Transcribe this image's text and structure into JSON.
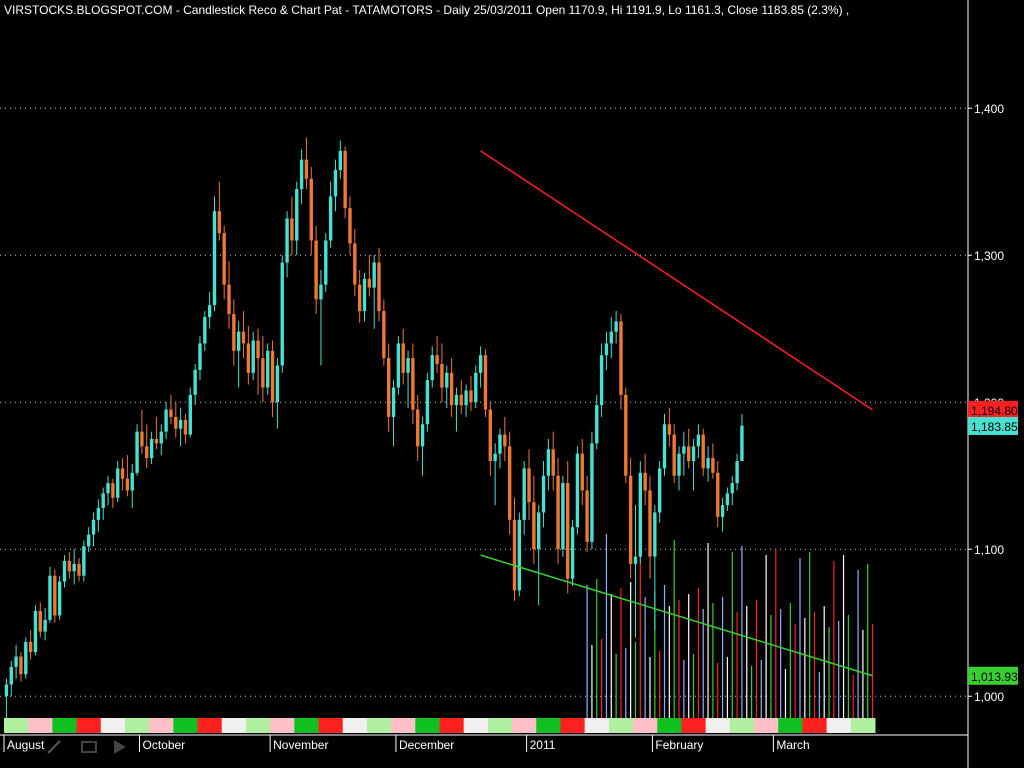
{
  "header": {
    "title": "VIRSTOCKS.BLOGSPOT.COM - Candlestick Reco & Chart Pat - TATAMOTORS - Daily 25/03/2011 Open 1170.9, Hi 1191.9, Lo 1161.3, Close 1183.85 (2.3%) ,"
  },
  "colors": {
    "background": "#000000",
    "up_candle": "#48e0d0",
    "down_candle": "#f07830",
    "resistance_line": "#ff2020",
    "support_line": "#38d030",
    "grid": "#ffffff",
    "axis": "#ffffff"
  },
  "chart_data": {
    "type": "candlestick",
    "symbol": "TATAMOTORS",
    "ylim": [
      975,
      1460
    ],
    "y_ticks": [
      1000,
      1100,
      1200,
      1300,
      1400
    ],
    "y_tick_labels": [
      "1,000",
      "1,100",
      "1,200",
      "1,300",
      "1,400"
    ],
    "x_labels": [
      {
        "label": "August",
        "index": 0
      },
      {
        "label": "October",
        "index": 28
      },
      {
        "label": "November",
        "index": 55
      },
      {
        "label": "December",
        "index": 81
      },
      {
        "label": "2011",
        "index": 108
      },
      {
        "label": "February",
        "index": 134
      },
      {
        "label": "March",
        "index": 159
      }
    ],
    "num_bars": 180,
    "price_tags": [
      {
        "label": "1,194.80",
        "value": 1194.8,
        "color": "#ff2020",
        "text_color": "#000000"
      },
      {
        "label": "1,183.85",
        "value": 1183.85,
        "color": "#48e0d0",
        "text_color": "#000000"
      },
      {
        "label": "1,013.93",
        "value": 1013.93,
        "color": "#38d030",
        "text_color": "#000000"
      }
    ],
    "trend_lines": [
      {
        "name": "resistance",
        "from": {
          "index": 98,
          "value": 1371
        },
        "to": {
          "index": 179,
          "value": 1194.8
        },
        "color": "#ff2020"
      },
      {
        "name": "support",
        "from": {
          "index": 98,
          "value": 1096
        },
        "to": {
          "index": 179,
          "value": 1013.93
        },
        "color": "#38d030"
      }
    ],
    "candles": [
      [
        1000,
        1012,
        985,
        1008
      ],
      [
        1008,
        1024,
        1000,
        1020
      ],
      [
        1020,
        1035,
        1012,
        1027
      ],
      [
        1027,
        1030,
        1010,
        1015
      ],
      [
        1015,
        1040,
        1012,
        1037
      ],
      [
        1037,
        1045,
        1025,
        1030
      ],
      [
        1030,
        1062,
        1028,
        1058
      ],
      [
        1058,
        1064,
        1040,
        1044
      ],
      [
        1044,
        1060,
        1038,
        1052
      ],
      [
        1052,
        1088,
        1050,
        1082
      ],
      [
        1082,
        1086,
        1050,
        1055
      ],
      [
        1055,
        1082,
        1052,
        1078
      ],
      [
        1078,
        1096,
        1074,
        1092
      ],
      [
        1092,
        1098,
        1080,
        1085
      ],
      [
        1085,
        1100,
        1076,
        1090
      ],
      [
        1090,
        1094,
        1078,
        1082
      ],
      [
        1082,
        1106,
        1078,
        1102
      ],
      [
        1102,
        1115,
        1098,
        1110
      ],
      [
        1110,
        1125,
        1102,
        1120
      ],
      [
        1120,
        1134,
        1112,
        1128
      ],
      [
        1128,
        1142,
        1120,
        1138
      ],
      [
        1138,
        1150,
        1130,
        1145
      ],
      [
        1145,
        1148,
        1128,
        1135
      ],
      [
        1135,
        1160,
        1132,
        1155
      ],
      [
        1155,
        1162,
        1140,
        1148
      ],
      [
        1148,
        1164,
        1136,
        1140
      ],
      [
        1140,
        1158,
        1128,
        1152
      ],
      [
        1152,
        1185,
        1150,
        1180
      ],
      [
        1180,
        1195,
        1165,
        1170
      ],
      [
        1170,
        1185,
        1155,
        1162
      ],
      [
        1162,
        1180,
        1158,
        1175
      ],
      [
        1175,
        1190,
        1168,
        1172
      ],
      [
        1172,
        1185,
        1164,
        1180
      ],
      [
        1180,
        1200,
        1175,
        1195
      ],
      [
        1195,
        1205,
        1185,
        1190
      ],
      [
        1190,
        1200,
        1176,
        1182
      ],
      [
        1182,
        1196,
        1170,
        1188
      ],
      [
        1188,
        1192,
        1172,
        1178
      ],
      [
        1178,
        1210,
        1176,
        1205
      ],
      [
        1205,
        1226,
        1198,
        1222
      ],
      [
        1222,
        1245,
        1215,
        1240
      ],
      [
        1240,
        1262,
        1235,
        1258
      ],
      [
        1258,
        1275,
        1250,
        1266
      ],
      [
        1266,
        1340,
        1262,
        1330
      ],
      [
        1330,
        1350,
        1310,
        1315
      ],
      [
        1315,
        1320,
        1270,
        1280
      ],
      [
        1280,
        1296,
        1250,
        1260
      ],
      [
        1260,
        1270,
        1225,
        1235
      ],
      [
        1235,
        1255,
        1210,
        1248
      ],
      [
        1248,
        1262,
        1230,
        1240
      ],
      [
        1240,
        1252,
        1212,
        1220
      ],
      [
        1220,
        1248,
        1215,
        1242
      ],
      [
        1242,
        1250,
        1205,
        1230
      ],
      [
        1230,
        1245,
        1200,
        1210
      ],
      [
        1210,
        1240,
        1205,
        1235
      ],
      [
        1235,
        1242,
        1190,
        1200
      ],
      [
        1200,
        1230,
        1182,
        1225
      ],
      [
        1225,
        1300,
        1220,
        1295
      ],
      [
        1295,
        1330,
        1285,
        1325
      ],
      [
        1325,
        1340,
        1300,
        1310
      ],
      [
        1310,
        1350,
        1300,
        1345
      ],
      [
        1345,
        1372,
        1335,
        1365
      ],
      [
        1365,
        1380,
        1345,
        1352
      ],
      [
        1352,
        1360,
        1300,
        1310
      ],
      [
        1310,
        1320,
        1260,
        1270
      ],
      [
        1270,
        1290,
        1225,
        1280
      ],
      [
        1280,
        1315,
        1275,
        1310
      ],
      [
        1310,
        1350,
        1305,
        1340
      ],
      [
        1340,
        1365,
        1330,
        1358
      ],
      [
        1358,
        1378,
        1352,
        1371
      ],
      [
        1371,
        1374,
        1325,
        1332
      ],
      [
        1332,
        1340,
        1300,
        1308
      ],
      [
        1308,
        1318,
        1272,
        1280
      ],
      [
        1280,
        1290,
        1254,
        1262
      ],
      [
        1262,
        1288,
        1255,
        1284
      ],
      [
        1284,
        1300,
        1272,
        1278
      ],
      [
        1278,
        1300,
        1250,
        1295
      ],
      [
        1295,
        1305,
        1255,
        1262
      ],
      [
        1262,
        1270,
        1225,
        1230
      ],
      [
        1230,
        1240,
        1180,
        1190
      ],
      [
        1190,
        1215,
        1170,
        1210
      ],
      [
        1210,
        1245,
        1205,
        1240
      ],
      [
        1240,
        1250,
        1212,
        1220
      ],
      [
        1220,
        1235,
        1196,
        1230
      ],
      [
        1230,
        1240,
        1185,
        1195
      ],
      [
        1195,
        1205,
        1160,
        1170
      ],
      [
        1170,
        1190,
        1150,
        1185
      ],
      [
        1185,
        1220,
        1180,
        1215
      ],
      [
        1215,
        1238,
        1210,
        1232
      ],
      [
        1232,
        1245,
        1220,
        1226
      ],
      [
        1226,
        1240,
        1200,
        1210
      ],
      [
        1210,
        1225,
        1196,
        1220
      ],
      [
        1220,
        1230,
        1190,
        1198
      ],
      [
        1198,
        1210,
        1180,
        1205
      ],
      [
        1205,
        1215,
        1192,
        1198
      ],
      [
        1198,
        1212,
        1190,
        1208
      ],
      [
        1208,
        1218,
        1194,
        1200
      ],
      [
        1200,
        1225,
        1196,
        1220
      ],
      [
        1220,
        1238,
        1210,
        1232
      ],
      [
        1232,
        1236,
        1190,
        1195
      ],
      [
        1195,
        1200,
        1150,
        1160
      ],
      [
        1160,
        1172,
        1130,
        1165
      ],
      [
        1165,
        1182,
        1155,
        1178
      ],
      [
        1178,
        1190,
        1160,
        1170
      ],
      [
        1170,
        1180,
        1110,
        1120
      ],
      [
        1120,
        1135,
        1065,
        1072
      ],
      [
        1072,
        1125,
        1068,
        1120
      ],
      [
        1120,
        1160,
        1110,
        1155
      ],
      [
        1155,
        1168,
        1120,
        1132
      ],
      [
        1132,
        1150,
        1090,
        1100
      ],
      [
        1100,
        1130,
        1062,
        1125
      ],
      [
        1125,
        1160,
        1115,
        1150
      ],
      [
        1150,
        1175,
        1140,
        1168
      ],
      [
        1168,
        1180,
        1140,
        1150
      ],
      [
        1150,
        1162,
        1090,
        1100
      ],
      [
        1100,
        1150,
        1095,
        1145
      ],
      [
        1145,
        1160,
        1070,
        1080
      ],
      [
        1080,
        1120,
        1075,
        1115
      ],
      [
        1115,
        1170,
        1110,
        1165
      ],
      [
        1165,
        1175,
        1130,
        1140
      ],
      [
        1140,
        1150,
        1098,
        1105
      ],
      [
        1105,
        1180,
        1100,
        1172
      ],
      [
        1172,
        1205,
        1168,
        1198
      ],
      [
        1198,
        1240,
        1190,
        1232
      ],
      [
        1232,
        1248,
        1222,
        1240
      ],
      [
        1240,
        1258,
        1230,
        1248
      ],
      [
        1248,
        1262,
        1240,
        1255
      ],
      [
        1255,
        1260,
        1195,
        1205
      ],
      [
        1205,
        1210,
        1145,
        1150
      ],
      [
        1150,
        1162,
        1080,
        1090
      ],
      [
        1090,
        1130,
        1040,
        1095
      ],
      [
        1095,
        1160,
        1090,
        1152
      ],
      [
        1152,
        1165,
        1130,
        1140
      ],
      [
        1140,
        1150,
        1080,
        1095
      ],
      [
        1095,
        1130,
        1045,
        1125
      ],
      [
        1125,
        1160,
        1118,
        1155
      ],
      [
        1155,
        1192,
        1150,
        1185
      ],
      [
        1185,
        1196,
        1170,
        1178
      ],
      [
        1178,
        1185,
        1145,
        1150
      ],
      [
        1150,
        1170,
        1140,
        1165
      ],
      [
        1165,
        1180,
        1150,
        1170
      ],
      [
        1170,
        1182,
        1155,
        1160
      ],
      [
        1160,
        1175,
        1140,
        1170
      ],
      [
        1170,
        1185,
        1162,
        1178
      ],
      [
        1178,
        1182,
        1150,
        1155
      ],
      [
        1155,
        1170,
        1146,
        1162
      ],
      [
        1162,
        1172,
        1148,
        1152
      ],
      [
        1152,
        1160,
        1115,
        1122
      ],
      [
        1122,
        1135,
        1112,
        1130
      ],
      [
        1130,
        1142,
        1126,
        1138
      ],
      [
        1138,
        1150,
        1130,
        1145
      ],
      [
        1145,
        1165,
        1140,
        1160
      ],
      [
        1160,
        1192,
        1161,
        1184
      ]
    ]
  }
}
